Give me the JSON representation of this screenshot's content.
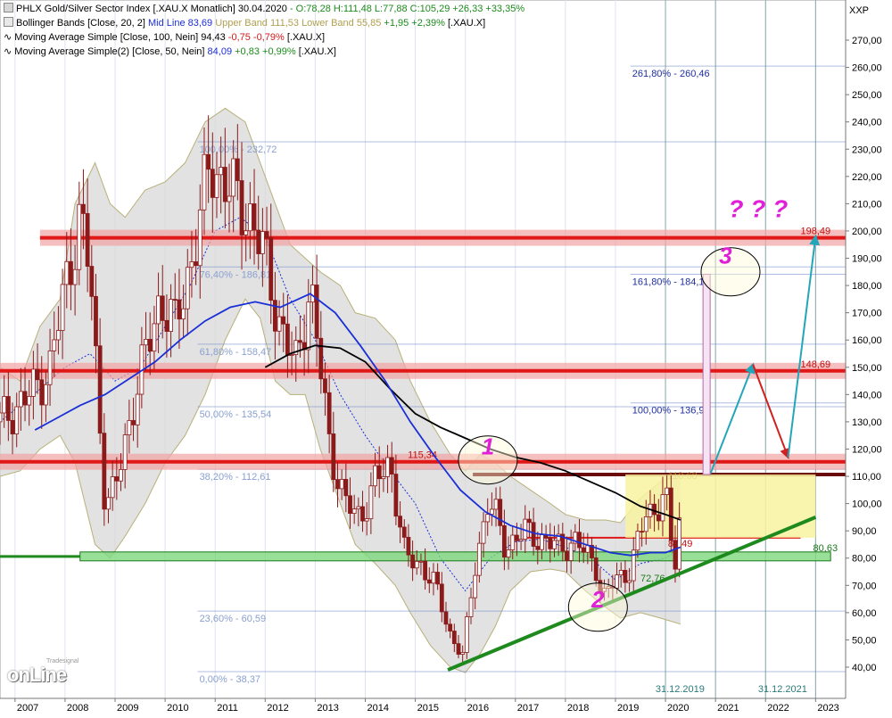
{
  "legend": {
    "l1_title": "PHLX Gold/Silver Sector Index [.XAU.X  Monatlich] 30.04.2020",
    "l1_ohlc": " - O:78,28 H:111,48 L:77,88 C:105,29 +26,33 +33,35%",
    "l2_title": "Bollinger Bands [Close, 20, 2] ",
    "l2_mid": "Mid Line 83,69",
    "l2_upper": "Upper Band 111,53",
    "l2_lower": "Lower Band 55,85",
    "l2_change": "+1,95 +2,39%",
    "l2_sym": " [.XAU.X]",
    "l3_title": "Moving Average Simple [Close, 100, Nein] ",
    "l3_val": "94,43",
    "l3_change": "-0,75 -0,79%",
    "l3_sym": " [.XAU.X]",
    "l4_title": "Moving Average Simple(2) [Close, 50, Nein] ",
    "l4_val": "84,09",
    "l4_change": "+0,83 +0,99%",
    "l4_sym": " [.XAU.X]"
  },
  "colors": {
    "candle": "#8b1a1a",
    "bollinger_fill": "#d8d8d8",
    "bollinger_line": "#b8b078",
    "ma100": "#000000",
    "ma50": "#1a2fd6",
    "resistance": "#e01818",
    "support": "#1e8a1e",
    "fib": "#6a86c8",
    "annot": "#e020d8",
    "arrow_up": "#22a6b8",
    "arrow_down": "#d02020"
  },
  "chart_data": {
    "type": "candlestick",
    "title": "PHLX Gold/Silver Sector Index [.XAU.X  Monatlich]",
    "y_axis_label": "XXP",
    "ylim": [
      30,
      280
    ],
    "y_ticks": [
      "40,00",
      "50,00",
      "60,00",
      "70,00",
      "80,00",
      "90,00",
      "100,00",
      "110,00",
      "120,00",
      "130,00",
      "140,00",
      "150,00",
      "160,00",
      "170,00",
      "180,00",
      "190,00",
      "200,00",
      "210,00",
      "220,00",
      "230,00",
      "240,00",
      "250,00",
      "260,00",
      "270,00"
    ],
    "x_ticks": [
      "2007",
      "2008",
      "2009",
      "2010",
      "2011",
      "2012",
      "2013",
      "2014",
      "2015",
      "2016",
      "2017",
      "2018",
      "2019",
      "2020",
      "2021",
      "2022",
      "2023"
    ],
    "x_range": [
      2006.7,
      2023.6
    ],
    "price_path": [
      [
        2006.7,
        130
      ],
      [
        2007.3,
        140
      ],
      [
        2007.7,
        150
      ],
      [
        2008.0,
        180
      ],
      [
        2008.3,
        205
      ],
      [
        2008.5,
        185
      ],
      [
        2008.8,
        100
      ],
      [
        2009.0,
        105
      ],
      [
        2009.4,
        140
      ],
      [
        2009.9,
        175
      ],
      [
        2010.2,
        165
      ],
      [
        2010.6,
        195
      ],
      [
        2010.9,
        225
      ],
      [
        2011.3,
        215
      ],
      [
        2011.7,
        205
      ],
      [
        2012.0,
        190
      ],
      [
        2012.3,
        165
      ],
      [
        2012.6,
        150
      ],
      [
        2012.9,
        180
      ],
      [
        2013.1,
        150
      ],
      [
        2013.3,
        120
      ],
      [
        2013.6,
        100
      ],
      [
        2013.9,
        95
      ],
      [
        2014.2,
        108
      ],
      [
        2014.5,
        115
      ],
      [
        2014.8,
        80
      ],
      [
        2015.1,
        78
      ],
      [
        2015.4,
        70
      ],
      [
        2015.7,
        52
      ],
      [
        2015.95,
        44
      ],
      [
        2016.2,
        78
      ],
      [
        2016.45,
        100
      ],
      [
        2016.6,
        96
      ],
      [
        2016.8,
        84
      ],
      [
        2017.2,
        90
      ],
      [
        2017.6,
        86
      ],
      [
        2017.9,
        84
      ],
      [
        2018.2,
        86
      ],
      [
        2018.6,
        78
      ],
      [
        2018.75,
        65
      ],
      [
        2019.0,
        72
      ],
      [
        2019.3,
        76
      ],
      [
        2019.6,
        96
      ],
      [
        2019.8,
        98
      ],
      [
        2020.0,
        104
      ],
      [
        2020.1,
        87
      ],
      [
        2020.2,
        78
      ],
      [
        2020.35,
        108
      ]
    ],
    "candle_step": 0.0833,
    "series": [
      {
        "name": "Moving Average Simple [Close, 100, Nein]",
        "points": [
          [
            2012.0,
            150
          ],
          [
            2012.5,
            155
          ],
          [
            2013.0,
            158
          ],
          [
            2013.5,
            157
          ],
          [
            2014.0,
            152
          ],
          [
            2014.5,
            142
          ],
          [
            2015.0,
            133
          ],
          [
            2015.5,
            128
          ],
          [
            2016.0,
            124
          ],
          [
            2016.5,
            120
          ],
          [
            2017.0,
            117
          ],
          [
            2017.5,
            115
          ],
          [
            2018.0,
            112
          ],
          [
            2018.5,
            108
          ],
          [
            2019.0,
            104
          ],
          [
            2019.5,
            99
          ],
          [
            2020.0,
            96
          ],
          [
            2020.3,
            94
          ]
        ]
      },
      {
        "name": "Moving Average Simple(2) [Close, 50, Nein]",
        "points": [
          [
            2007.4,
            127
          ],
          [
            2007.8,
            131
          ],
          [
            2008.3,
            136
          ],
          [
            2008.8,
            140
          ],
          [
            2009.3,
            146
          ],
          [
            2009.8,
            152
          ],
          [
            2010.3,
            160
          ],
          [
            2010.8,
            167
          ],
          [
            2011.3,
            172
          ],
          [
            2011.8,
            174
          ],
          [
            2012.3,
            172
          ],
          [
            2012.9,
            177
          ],
          [
            2013.4,
            170
          ],
          [
            2013.9,
            158
          ],
          [
            2014.4,
            145
          ],
          [
            2014.9,
            130
          ],
          [
            2015.4,
            117
          ],
          [
            2015.9,
            105
          ],
          [
            2016.4,
            97
          ],
          [
            2016.9,
            92
          ],
          [
            2017.4,
            89
          ],
          [
            2017.9,
            88
          ],
          [
            2018.4,
            85
          ],
          [
            2018.9,
            82
          ],
          [
            2019.3,
            81
          ],
          [
            2019.7,
            82
          ],
          [
            2020.0,
            82
          ],
          [
            2020.3,
            84
          ]
        ]
      },
      {
        "name": "Bollinger Upper Band",
        "points": [
          [
            2006.7,
            150
          ],
          [
            2007.1,
            145
          ],
          [
            2007.5,
            165
          ],
          [
            2007.9,
            175
          ],
          [
            2008.2,
            210
          ],
          [
            2008.6,
            225
          ],
          [
            2008.9,
            210
          ],
          [
            2009.2,
            205
          ],
          [
            2009.6,
            215
          ],
          [
            2010.0,
            218
          ],
          [
            2010.4,
            225
          ],
          [
            2010.8,
            240
          ],
          [
            2011.2,
            245
          ],
          [
            2011.6,
            240
          ],
          [
            2011.9,
            225
          ],
          [
            2012.2,
            210
          ],
          [
            2012.5,
            195
          ],
          [
            2012.8,
            190
          ],
          [
            2013.1,
            185
          ],
          [
            2013.5,
            180
          ],
          [
            2013.8,
            170
          ],
          [
            2014.2,
            168
          ],
          [
            2014.6,
            160
          ],
          [
            2014.9,
            145
          ],
          [
            2015.3,
            130
          ],
          [
            2015.7,
            118
          ],
          [
            2016.0,
            112
          ],
          [
            2016.3,
            118
          ],
          [
            2016.6,
            115
          ],
          [
            2016.9,
            110
          ],
          [
            2017.3,
            105
          ],
          [
            2017.7,
            100
          ],
          [
            2018.0,
            96
          ],
          [
            2018.4,
            94
          ],
          [
            2018.8,
            94
          ],
          [
            2019.1,
            93
          ],
          [
            2019.5,
            102
          ],
          [
            2019.9,
            108
          ],
          [
            2020.3,
            111.5
          ]
        ]
      },
      {
        "name": "Bollinger Lower Band",
        "points": [
          [
            2006.7,
            110
          ],
          [
            2007.1,
            112
          ],
          [
            2007.5,
            120
          ],
          [
            2007.9,
            125
          ],
          [
            2008.2,
            115
          ],
          [
            2008.6,
            85
          ],
          [
            2008.9,
            80
          ],
          [
            2009.2,
            88
          ],
          [
            2009.6,
            100
          ],
          [
            2010.0,
            115
          ],
          [
            2010.4,
            125
          ],
          [
            2010.8,
            140
          ],
          [
            2011.2,
            160
          ],
          [
            2011.6,
            175
          ],
          [
            2011.9,
            168
          ],
          [
            2012.2,
            145
          ],
          [
            2012.5,
            140
          ],
          [
            2012.8,
            140
          ],
          [
            2013.1,
            120
          ],
          [
            2013.5,
            100
          ],
          [
            2013.8,
            85
          ],
          [
            2014.2,
            78
          ],
          [
            2014.6,
            70
          ],
          [
            2014.9,
            60
          ],
          [
            2015.3,
            48
          ],
          [
            2015.7,
            40
          ],
          [
            2016.0,
            38
          ],
          [
            2016.3,
            45
          ],
          [
            2016.6,
            55
          ],
          [
            2016.9,
            68
          ],
          [
            2017.3,
            75
          ],
          [
            2017.7,
            76
          ],
          [
            2018.0,
            75
          ],
          [
            2018.4,
            68
          ],
          [
            2018.8,
            62
          ],
          [
            2019.1,
            58
          ],
          [
            2019.5,
            60
          ],
          [
            2019.9,
            58
          ],
          [
            2020.3,
            55.8
          ]
        ]
      },
      {
        "name": "Bollinger Mid Line",
        "points": [
          [
            2006.7,
            130
          ],
          [
            2007.5,
            142
          ],
          [
            2008.0,
            150
          ],
          [
            2008.5,
            155
          ],
          [
            2009.0,
            145
          ],
          [
            2009.5,
            150
          ],
          [
            2010.0,
            165
          ],
          [
            2010.5,
            180
          ],
          [
            2011.0,
            200
          ],
          [
            2011.5,
            205
          ],
          [
            2012.0,
            198
          ],
          [
            2012.5,
            175
          ],
          [
            2013.0,
            160
          ],
          [
            2013.5,
            140
          ],
          [
            2014.0,
            125
          ],
          [
            2014.5,
            112
          ],
          [
            2015.0,
            100
          ],
          [
            2015.5,
            80
          ],
          [
            2016.0,
            68
          ],
          [
            2016.5,
            80
          ],
          [
            2017.0,
            86
          ],
          [
            2017.5,
            87
          ],
          [
            2018.0,
            84
          ],
          [
            2018.5,
            80
          ],
          [
            2019.0,
            72
          ],
          [
            2019.5,
            78
          ],
          [
            2020.0,
            80
          ],
          [
            2020.3,
            83.7
          ]
        ]
      }
    ],
    "fibonacci": [
      {
        "label": "0,00% - 38,37",
        "value": 38.37
      },
      {
        "label": "23,60% - 60,59",
        "value": 60.59
      },
      {
        "label": "38,20% - 112,61",
        "value": 112.61
      },
      {
        "label": "50,00% - 135,54",
        "value": 135.54
      },
      {
        "label": "61,80% - 158,47",
        "value": 158.47
      },
      {
        "label": "76,40% - 186,81",
        "value": 186.81
      },
      {
        "label": "100,00% - 232,72",
        "value": 232.72
      },
      {
        "label": "100,00% - 136,93",
        "value": 136.93
      },
      {
        "label": "161,80% - 184,12",
        "value": 184.12
      },
      {
        "label": "261,80% - 260,46",
        "value": 260.46
      }
    ],
    "levels": [
      {
        "label": "198,49",
        "value": 197.5,
        "kind": "resistance"
      },
      {
        "label": "148,69",
        "value": 148.69,
        "kind": "resistance"
      },
      {
        "label": "115,34",
        "value": 115.34,
        "kind": "resistance"
      },
      {
        "label": "110,68",
        "value": 110.68,
        "kind": "dark"
      },
      {
        "label": "87,49",
        "value": 87.49,
        "kind": "thin"
      },
      {
        "label": "80,63",
        "value": 80.63,
        "kind": "support"
      },
      {
        "label": "72,76",
        "value": 72.76,
        "kind": "label"
      }
    ],
    "annotations": [
      {
        "text": "1",
        "x": 2016.45,
        "y": 118
      },
      {
        "text": "2",
        "x": 2018.65,
        "y": 62
      },
      {
        "text": "3",
        "x": 2021.2,
        "y": 188
      },
      {
        "text": "? ? ?",
        "x": 2021.85,
        "y": 205
      }
    ],
    "date_labels": [
      "31.12.2019",
      "31.12.2021"
    ],
    "trendline": [
      [
        2015.65,
        39
      ],
      [
        2023.0,
        95
      ]
    ],
    "forecast_up": [
      [
        2020.9,
        111
      ],
      [
        2021.75,
        151
      ]
    ],
    "forecast_down": [
      [
        2021.75,
        151
      ],
      [
        2022.45,
        117
      ]
    ],
    "forecast_up2": [
      [
        2022.45,
        117
      ],
      [
        2023.0,
        198
      ]
    ]
  }
}
